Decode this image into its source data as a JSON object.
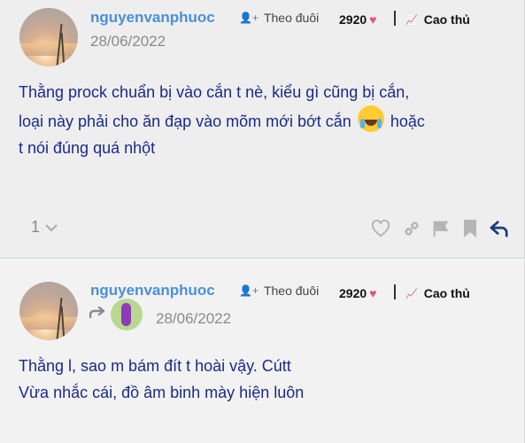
{
  "posts": [
    {
      "username": "nguyenvanphuoc",
      "follow_label": "Theo đuôi",
      "score": "2920",
      "rank": "Cao thủ",
      "date": "28/06/2022",
      "body_lines": [
        "Thằng prock chuẩn bị vào cắn t nè, kiểu gì cũng bị cắn,",
        "loại này phải cho ăn đạp vào mõm mới bớt cắn",
        "hoặc",
        "t nói đúng quá nhột"
      ],
      "like_count": "1"
    },
    {
      "username": "nguyenvanphuoc",
      "follow_label": "Theo đuôi",
      "score": "2920",
      "rank": "Cao thủ",
      "date": "28/06/2022",
      "body_lines": [
        "Thằng l, sao m bám đít t hoài vậy. Cútt",
        "Vừa nhắc cái, đồ âm binh mày hiện luôn"
      ]
    }
  ],
  "icons": {
    "follow": "add-user-icon",
    "heart": "heart-icon",
    "rank": "trend-icon",
    "like": "heart-outline-icon",
    "link": "link-icon",
    "flag": "flag-icon",
    "bookmark": "bookmark-icon",
    "reply": "reply-icon"
  },
  "colors": {
    "username": "#4a90d9",
    "body_text": "#1b2a8a",
    "heart": "#e0547c",
    "reply_active": "#1b3a7a"
  }
}
